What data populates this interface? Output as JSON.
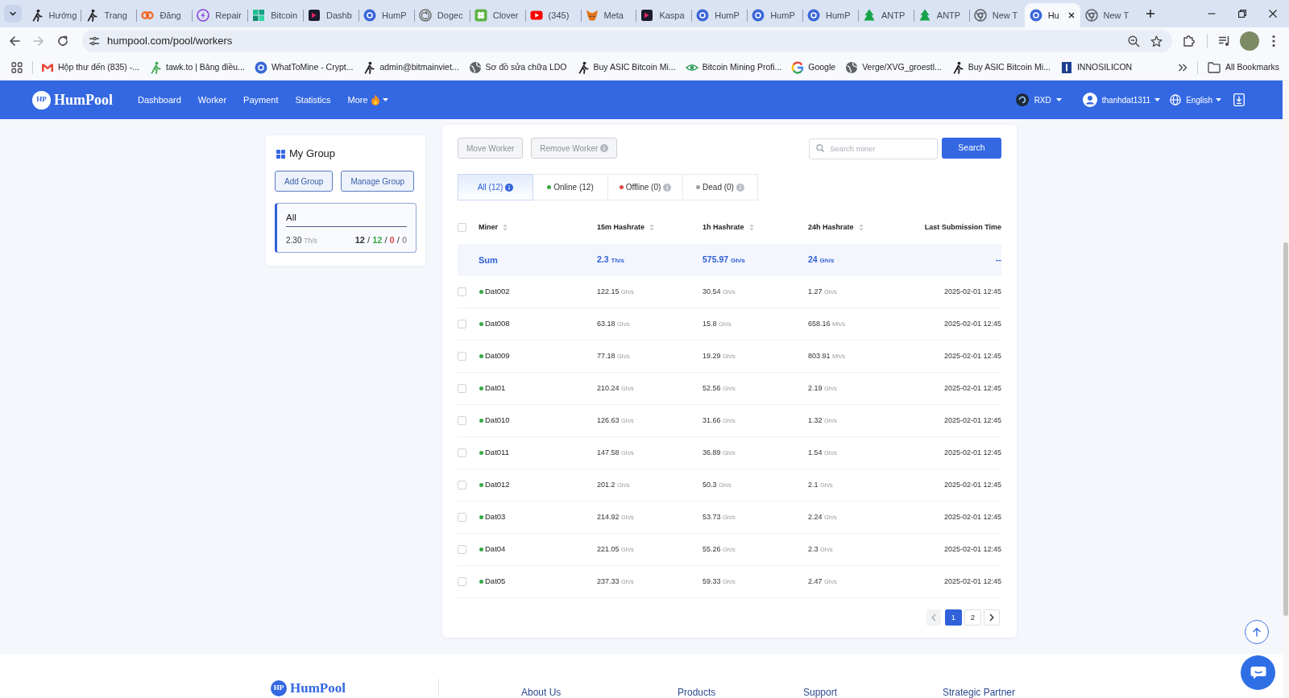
{
  "browser": {
    "tabs": [
      {
        "title": "Hướng",
        "selected": false
      },
      {
        "title": "Trang",
        "selected": false
      },
      {
        "title": "Đăng",
        "selected": false
      },
      {
        "title": "Repair",
        "selected": false
      },
      {
        "title": "Bitcoin",
        "selected": false
      },
      {
        "title": "Dashb",
        "selected": false
      },
      {
        "title": "HumP",
        "selected": false
      },
      {
        "title": "Dogec",
        "selected": false
      },
      {
        "title": "Clover",
        "selected": false
      },
      {
        "title": "(345)",
        "selected": false
      },
      {
        "title": "Meta",
        "selected": false
      },
      {
        "title": "Kaspa",
        "selected": false
      },
      {
        "title": "HumP",
        "selected": false
      },
      {
        "title": "HumP",
        "selected": false
      },
      {
        "title": "HumP",
        "selected": false
      },
      {
        "title": "ANTP",
        "selected": false
      },
      {
        "title": "ANTP",
        "selected": false
      },
      {
        "title": "New T",
        "selected": false
      },
      {
        "title": "Hu",
        "selected": true
      },
      {
        "title": "New T",
        "selected": false
      }
    ],
    "forward_disabled": true,
    "url": "humpool.com/pool/workers",
    "bookmarks": [
      "Hộp thư đến (835) -...",
      "tawk.to | Bảng điều...",
      "WhatToMine - Crypt...",
      "admin@bitmainviet...",
      "Sơ đồ sửa chữa LDO",
      "Buy ASIC Bitcoin Mi...",
      "Bitcoin Mining Profi...",
      "Google",
      "Verge/XVG_groestl...",
      "Buy ASIC Bitcoin Mi...",
      "INNOSILICON"
    ],
    "all_bookmarks": "All Bookmarks"
  },
  "navbar": {
    "logo_mark": "HP",
    "logo": "HumPool",
    "links": [
      {
        "label": "Dashboard",
        "dropdown": false
      },
      {
        "label": "Worker",
        "dropdown": false
      },
      {
        "label": "Payment",
        "dropdown": false
      },
      {
        "label": "Statistics",
        "dropdown": false
      },
      {
        "label": "More",
        "dropdown": true
      }
    ],
    "coin": "RXD",
    "user": "thanhdat1311",
    "language": "English"
  },
  "group_panel": {
    "title": "My Group",
    "buttons": [
      "Add Group",
      "Manage Group"
    ],
    "groups": [
      {
        "name": "All",
        "selected": true,
        "hashrate": "2.30",
        "unit": "Th/s",
        "separator": "/",
        "counts": [
          {
            "value": "12",
            "color": "#333333"
          },
          {
            "value": "12",
            "color": "#3aa845"
          },
          {
            "value": "0",
            "color": "#e04848"
          },
          {
            "value": "0",
            "color": "#9e9e9e"
          }
        ]
      }
    ]
  },
  "workers": {
    "actions": [
      {
        "label": "Move Worker",
        "disabled": true,
        "info": false
      },
      {
        "label": "Remove Worker",
        "disabled": true,
        "info": true
      }
    ],
    "search": {
      "placeholder": "Search miner",
      "button": "Search"
    },
    "filters": [
      {
        "label": "All (12)",
        "selected": true,
        "info": true
      },
      {
        "label": "Online (12)",
        "selected": false,
        "color": "#3aa845",
        "info": false
      },
      {
        "label": "Offline (0)",
        "selected": false,
        "color": "#e04848",
        "info": true
      },
      {
        "label": "Dead (0)",
        "selected": false,
        "color": "#9e9e9e",
        "info": true
      }
    ],
    "table": {
      "select_all_checked": false,
      "columns": [
        {
          "label": "Miner",
          "sortable": true
        },
        {
          "label": "15m Hashrate",
          "sortable": true
        },
        {
          "label": "1h Hashrate",
          "sortable": true
        },
        {
          "label": "24h Hashrate",
          "sortable": true
        },
        {
          "label": "Last Submission Time",
          "sortable": false
        }
      ],
      "sum": {
        "label": "Sum",
        "hashrates": [
          {
            "value": "2.3",
            "unit": "Th/s"
          },
          {
            "value": "575.97",
            "unit": "Gh/s"
          },
          {
            "value": "24",
            "unit": "Gh/s"
          }
        ],
        "last_submission": "--"
      },
      "rows": [
        {
          "name": "Dat002",
          "color": "#3aa845",
          "checked": false,
          "hashrates": [
            {
              "value": "122.15",
              "unit": "Gh/s"
            },
            {
              "value": "30.54",
              "unit": "Gh/s"
            },
            {
              "value": "1.27",
              "unit": "Gh/s"
            }
          ],
          "last_submission": "2025-02-01 12:45"
        },
        {
          "name": "Dat008",
          "color": "#3aa845",
          "checked": false,
          "hashrates": [
            {
              "value": "63.18",
              "unit": "Gh/s"
            },
            {
              "value": "15.8",
              "unit": "Gh/s"
            },
            {
              "value": "658.16",
              "unit": "Mh/s"
            }
          ],
          "last_submission": "2025-02-01 12:45"
        },
        {
          "name": "Dat009",
          "color": "#3aa845",
          "checked": false,
          "hashrates": [
            {
              "value": "77.18",
              "unit": "Gh/s"
            },
            {
              "value": "19.29",
              "unit": "Gh/s"
            },
            {
              "value": "803.91",
              "unit": "Mh/s"
            }
          ],
          "last_submission": "2025-02-01 12:45"
        },
        {
          "name": "Dat01",
          "color": "#3aa845",
          "checked": false,
          "hashrates": [
            {
              "value": "210.24",
              "unit": "Gh/s"
            },
            {
              "value": "52.56",
              "unit": "Gh/s"
            },
            {
              "value": "2.19",
              "unit": "Gh/s"
            }
          ],
          "last_submission": "2025-02-01 12:45"
        },
        {
          "name": "Dat010",
          "color": "#3aa845",
          "checked": false,
          "hashrates": [
            {
              "value": "126.63",
              "unit": "Gh/s"
            },
            {
              "value": "31.66",
              "unit": "Gh/s"
            },
            {
              "value": "1.32",
              "unit": "Gh/s"
            }
          ],
          "last_submission": "2025-02-01 12:45"
        },
        {
          "name": "Dat011",
          "color": "#3aa845",
          "checked": false,
          "hashrates": [
            {
              "value": "147.58",
              "unit": "Gh/s"
            },
            {
              "value": "36.89",
              "unit": "Gh/s"
            },
            {
              "value": "1.54",
              "unit": "Gh/s"
            }
          ],
          "last_submission": "2025-02-01 12:45"
        },
        {
          "name": "Dat012",
          "color": "#3aa845",
          "checked": false,
          "hashrates": [
            {
              "value": "201.2",
              "unit": "Gh/s"
            },
            {
              "value": "50.3",
              "unit": "Gh/s"
            },
            {
              "value": "2.1",
              "unit": "Gh/s"
            }
          ],
          "last_submission": "2025-02-01 12:45"
        },
        {
          "name": "Dat03",
          "color": "#3aa845",
          "checked": false,
          "hashrates": [
            {
              "value": "214.92",
              "unit": "Gh/s"
            },
            {
              "value": "53.73",
              "unit": "Gh/s"
            },
            {
              "value": "2.24",
              "unit": "Gh/s"
            }
          ],
          "last_submission": "2025-02-01 12:45"
        },
        {
          "name": "Dat04",
          "color": "#3aa845",
          "checked": false,
          "hashrates": [
            {
              "value": "221.05",
              "unit": "Gh/s"
            },
            {
              "value": "55.26",
              "unit": "Gh/s"
            },
            {
              "value": "2.3",
              "unit": "Gh/s"
            }
          ],
          "last_submission": "2025-02-01 12:45"
        },
        {
          "name": "Dat05",
          "color": "#3aa845",
          "checked": false,
          "hashrates": [
            {
              "value": "237.33",
              "unit": "Gh/s"
            },
            {
              "value": "59.33",
              "unit": "Gh/s"
            },
            {
              "value": "2.47",
              "unit": "Gh/s"
            }
          ],
          "last_submission": "2025-02-01 12:45"
        }
      ]
    },
    "pagination": {
      "previous_disabled": true,
      "next_disabled": false,
      "pages": [
        {
          "label": "1",
          "selected": true
        },
        {
          "label": "2",
          "selected": false
        }
      ]
    }
  },
  "footer": {
    "logo_mark": "HP",
    "logo": "HumPool",
    "links": [
      "About Us",
      "Products",
      "Support",
      "Strategic Partner"
    ]
  }
}
